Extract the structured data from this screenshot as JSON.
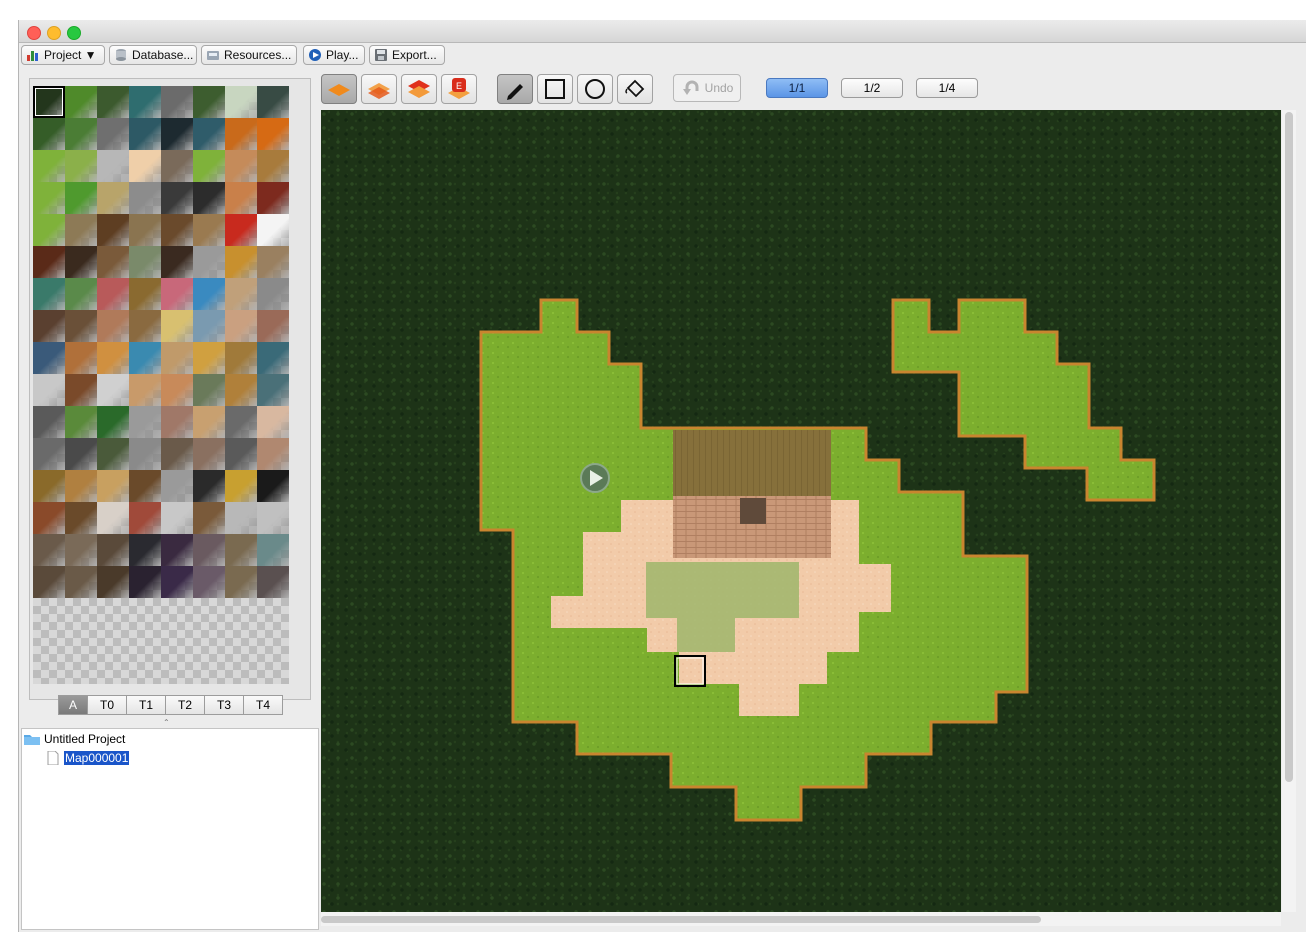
{
  "window": {
    "colors": {
      "close": "#ff5f57",
      "minimize": "#febc2e",
      "zoom": "#28c840"
    }
  },
  "toolbar": {
    "project_label": "Project ▼",
    "database_label": "Database...",
    "resources_label": "Resources...",
    "play_label": "Play...",
    "export_label": "Export..."
  },
  "layer_buttons": [
    {
      "name": "layer-lower",
      "icon": "layer-lower-icon"
    },
    {
      "name": "layer-upper",
      "icon": "layer-upper-icon"
    },
    {
      "name": "layer-top",
      "icon": "layer-top-icon"
    },
    {
      "name": "layer-events",
      "icon": "layer-events-icon",
      "badge": "E"
    }
  ],
  "draw_tools": [
    "pencil-icon",
    "rectangle-icon",
    "ellipse-icon",
    "fill-bucket-icon"
  ],
  "undo_label": "Undo",
  "scale_buttons": {
    "s1": "1/1",
    "s2": "1/2",
    "s3": "1/4",
    "active": "1/1"
  },
  "tileset_tabs": {
    "a": "A",
    "t0": "T0",
    "t1": "T1",
    "t2": "T2",
    "t3": "T3",
    "t4": "T4",
    "active": "A"
  },
  "tree": {
    "project": "Untitled Project",
    "map": "Map000001"
  },
  "map_colors": {
    "water_dark": "#1d3317",
    "grass": "#7fb02f",
    "dirt": "#f0c9a8",
    "roof": "#8a6f3a",
    "wall": "#c99b7a"
  }
}
